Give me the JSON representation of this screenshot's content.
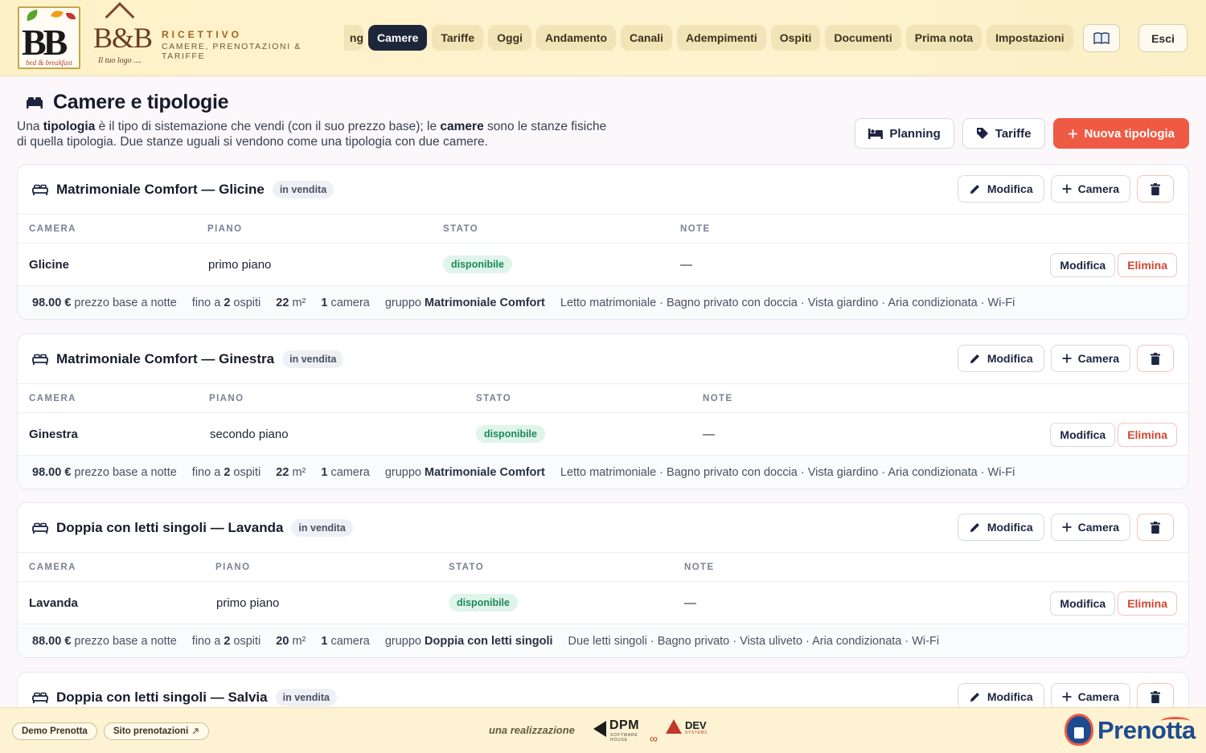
{
  "header": {
    "logo1": {
      "letters": "BB",
      "caption": "bed & breakfast"
    },
    "logo2": {
      "letters": "B&B",
      "caption": "Il tuo logo ...."
    },
    "brand_title": "RICETTIVO",
    "brand_subtitle": "CAMERE, PRENOTAZIONI & TARIFFE",
    "tabs": [
      {
        "label": "ng",
        "active": false
      },
      {
        "label": "Camere",
        "active": true
      },
      {
        "label": "Tariffe",
        "active": false
      },
      {
        "label": "Oggi",
        "active": false
      },
      {
        "label": "Andamento",
        "active": false
      },
      {
        "label": "Canali",
        "active": false
      },
      {
        "label": "Adempimenti",
        "active": false
      },
      {
        "label": "Ospiti",
        "active": false
      },
      {
        "label": "Documenti",
        "active": false
      },
      {
        "label": "Prima nota",
        "active": false
      },
      {
        "label": "Impostazioni",
        "active": false
      }
    ],
    "guide_icon": "book-icon",
    "logout_label": "Esci"
  },
  "page": {
    "title": "Camere e tipologie",
    "intro_parts": {
      "p1": "Una ",
      "b1": "tipologia",
      "p2": " è il tipo di sistemazione che vendi (con il suo prezzo base); le ",
      "b2": "camere",
      "p3": " sono le stanze fisiche di quella tipologia. Due stanze uguali si vendono come una tipologia con due camere."
    },
    "actions": {
      "planning": "Planning",
      "tariffe": "Tariffe",
      "new_type": "Nuova tipologia"
    }
  },
  "table_columns": [
    "CAMERA",
    "PIANO",
    "STATO",
    "NOTE"
  ],
  "card_actions": {
    "edit": "Modifica",
    "add_room": "Camera",
    "row_edit": "Modifica",
    "row_delete": "Elimina"
  },
  "cards": [
    {
      "title": "Matrimoniale Comfort — Glicine",
      "badge": "in vendita",
      "row": {
        "camera": "Glicine",
        "piano": "primo piano",
        "stato": "disponibile",
        "note": "—"
      },
      "info": {
        "price": "98.00 €",
        "price_label": "prezzo base a notte",
        "guests_pre": "fino a",
        "guests": "2",
        "guests_post": "ospiti",
        "size": "22",
        "size_unit": "m²",
        "rooms": "1",
        "rooms_label": "camera",
        "group_label": "gruppo",
        "group": "Matrimoniale Comfort",
        "features": "Letto matrimoniale · Bagno privato con doccia · Vista giardino · Aria condizionata · Wi-Fi"
      }
    },
    {
      "title": "Matrimoniale Comfort — Ginestra",
      "badge": "in vendita",
      "row": {
        "camera": "Ginestra",
        "piano": "secondo piano",
        "stato": "disponibile",
        "note": "—"
      },
      "info": {
        "price": "98.00 €",
        "price_label": "prezzo base a notte",
        "guests_pre": "fino a",
        "guests": "2",
        "guests_post": "ospiti",
        "size": "22",
        "size_unit": "m²",
        "rooms": "1",
        "rooms_label": "camera",
        "group_label": "gruppo",
        "group": "Matrimoniale Comfort",
        "features": "Letto matrimoniale · Bagno privato con doccia · Vista giardino · Aria condizionata · Wi-Fi"
      }
    },
    {
      "title": "Doppia con letti singoli — Lavanda",
      "badge": "in vendita",
      "row": {
        "camera": "Lavanda",
        "piano": "primo piano",
        "stato": "disponibile",
        "note": "—"
      },
      "info": {
        "price": "88.00 €",
        "price_label": "prezzo base a notte",
        "guests_pre": "fino a",
        "guests": "2",
        "guests_post": "ospiti",
        "size": "20",
        "size_unit": "m²",
        "rooms": "1",
        "rooms_label": "camera",
        "group_label": "gruppo",
        "group": "Doppia con letti singoli",
        "features": "Due letti singoli · Bagno privato · Vista uliveto · Aria condizionata · Wi-Fi"
      }
    },
    {
      "title": "Doppia con letti singoli — Salvia",
      "badge": "in vendita"
    }
  ],
  "footer": {
    "demo": "Demo Prenotta",
    "site": "Sito prenotazioni",
    "site_icon": "external-link-icon",
    "credit": "una realizzazione",
    "dpm": "DPM",
    "dpm_sub": "SOFTWARE HOUSE",
    "dev": "DEV",
    "dev_sub": "SYSTEMS",
    "brand": "Prenotta"
  },
  "colors": {
    "accent": "#ee5a44",
    "active_tab": "#1e2639",
    "status_green": "#1c8a5a",
    "brand_blue": "#1d4b8f"
  }
}
